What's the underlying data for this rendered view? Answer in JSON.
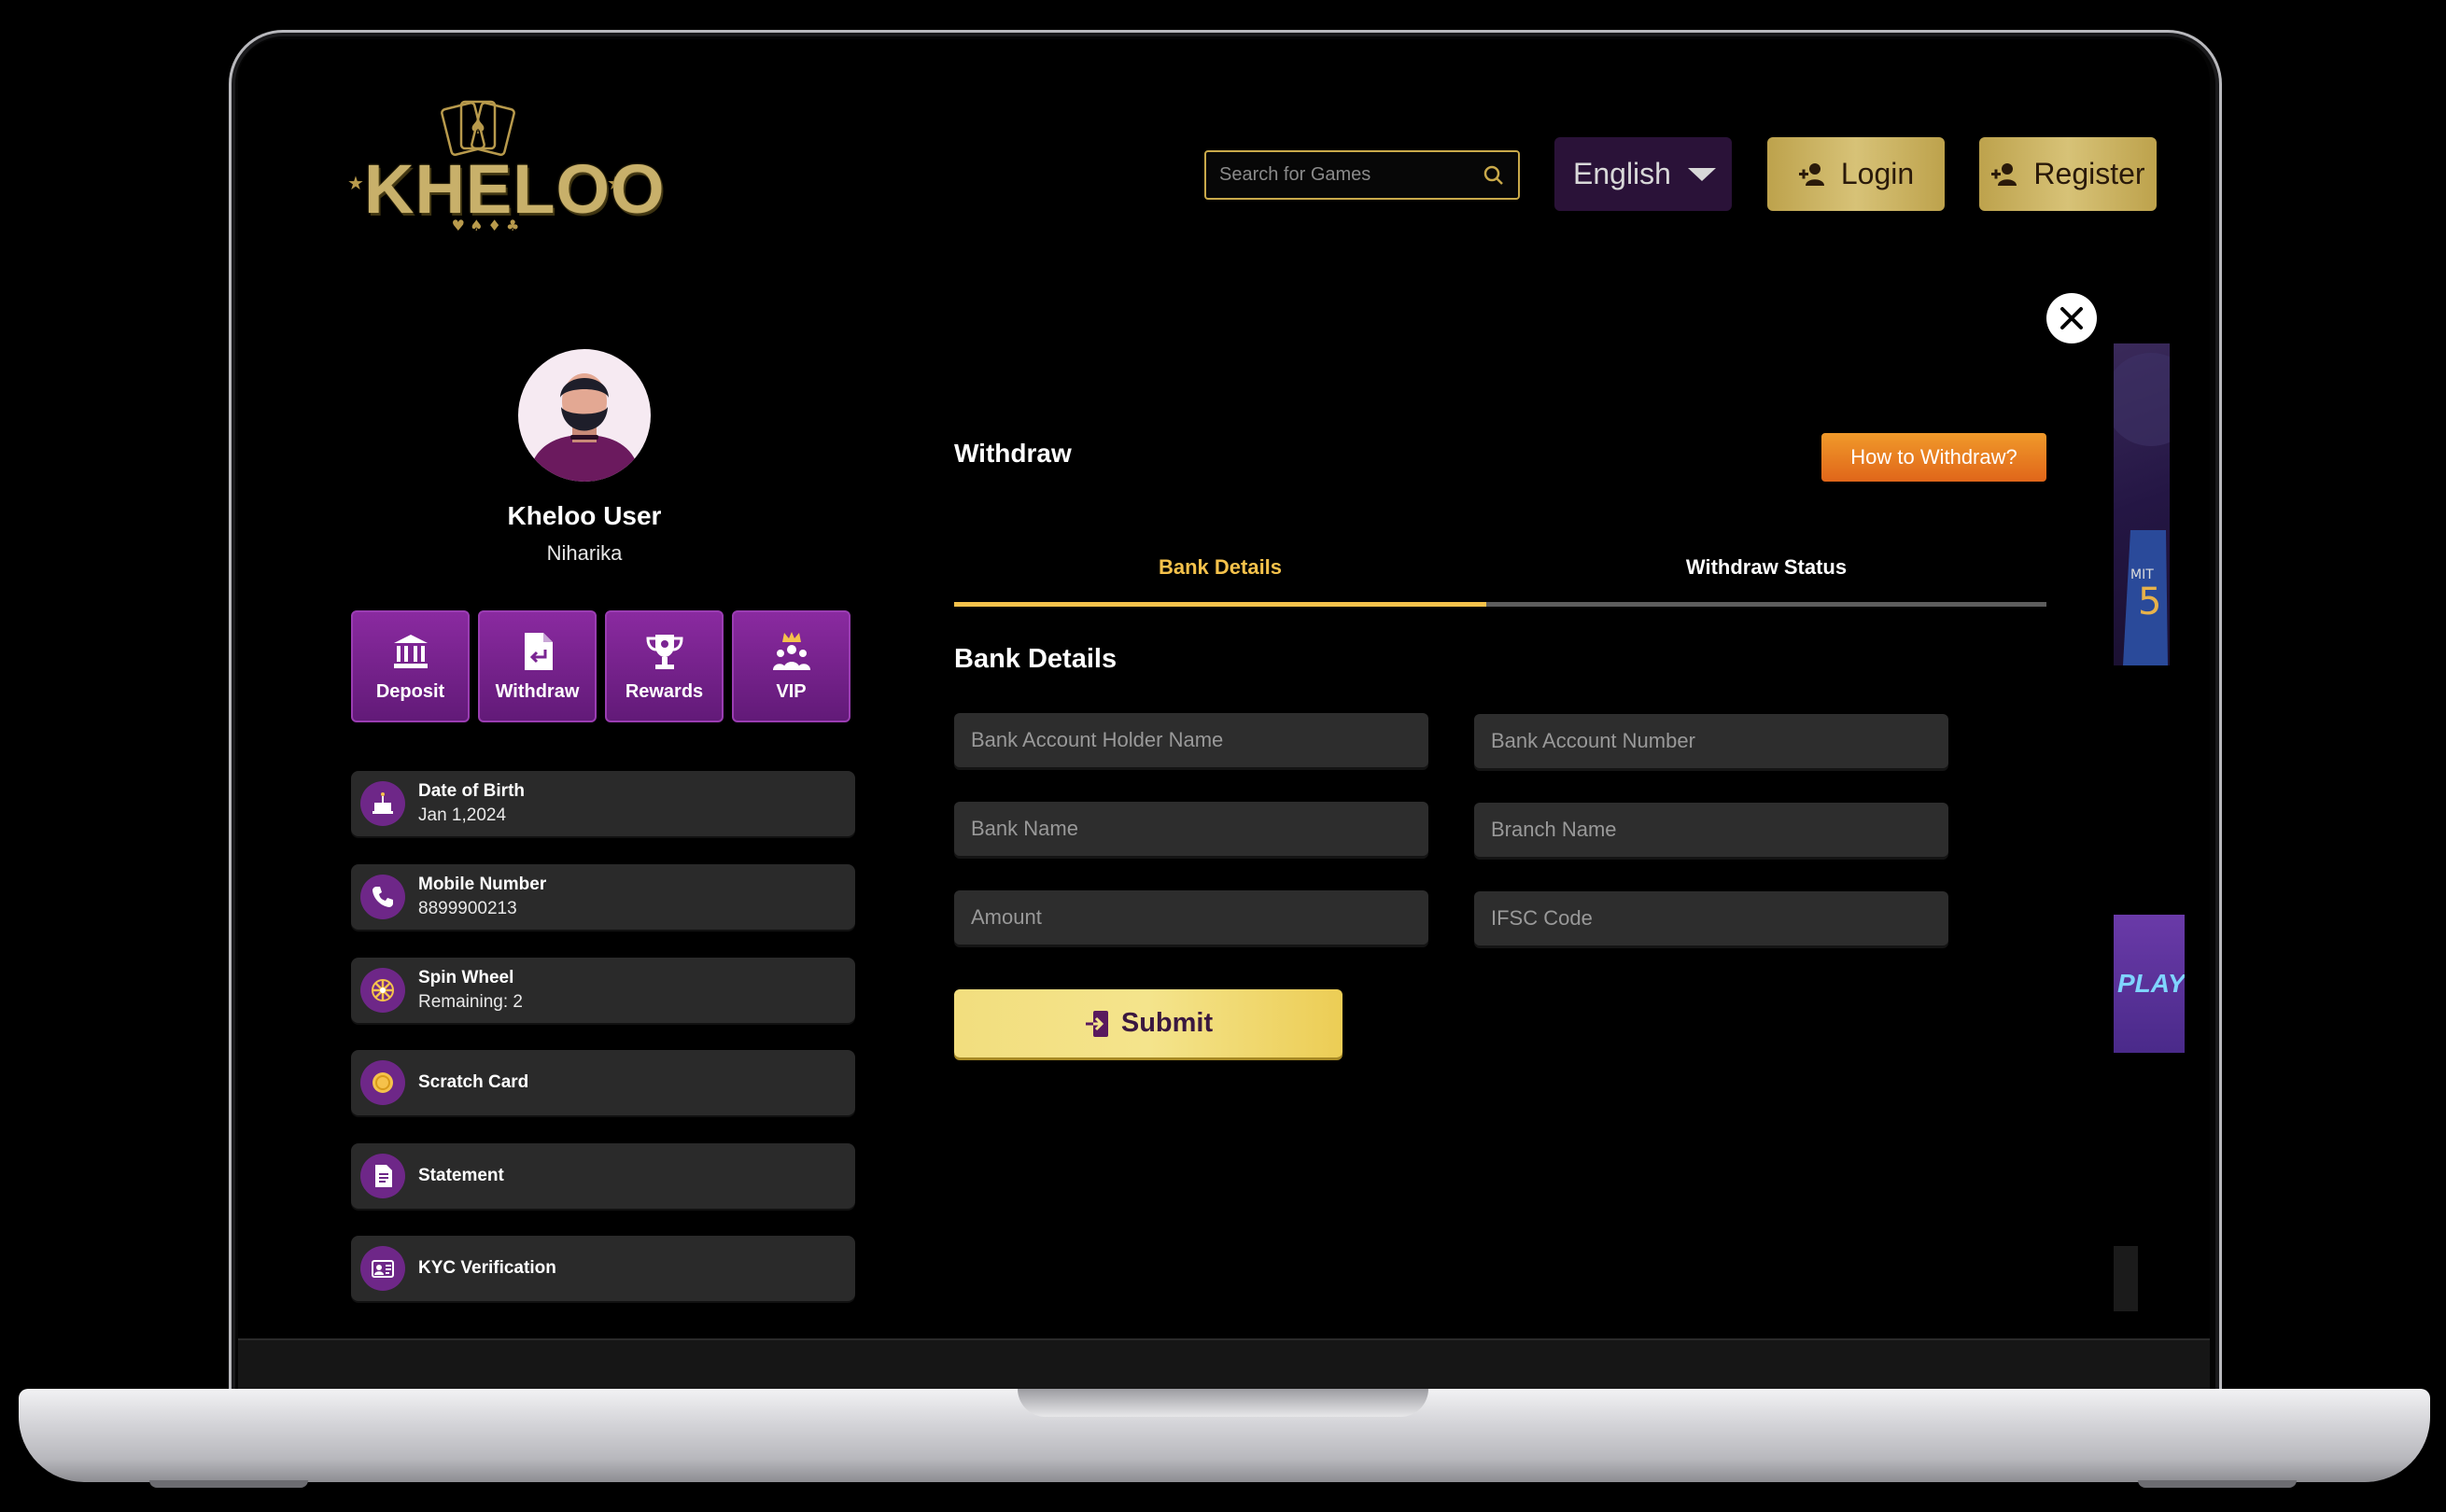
{
  "header": {
    "logo_text": "KHELOO",
    "search_placeholder": "Search for Games",
    "language": "English",
    "login_label": "Login",
    "register_label": "Register"
  },
  "profile": {
    "name": "Kheloo User",
    "username": "Niharika",
    "quick_actions": [
      {
        "label": "Deposit",
        "icon": "bank-icon"
      },
      {
        "label": "Withdraw",
        "icon": "withdraw-doc-icon"
      },
      {
        "label": "Rewards",
        "icon": "trophy-icon"
      },
      {
        "label": "VIP",
        "icon": "vip-crown-icon"
      }
    ],
    "info_rows": [
      {
        "title": "Date of Birth",
        "value": "Jan 1,2024",
        "icon": "cake-icon"
      },
      {
        "title": "Mobile Number",
        "value": "8899900213",
        "icon": "phone-icon"
      },
      {
        "title": "Spin Wheel",
        "value": "Remaining: 2",
        "icon": "spin-wheel-icon"
      },
      {
        "title": "Scratch Card",
        "icon": "coin-icon"
      },
      {
        "title": "Statement",
        "icon": "document-icon"
      },
      {
        "title": "KYC Verification",
        "icon": "id-card-icon"
      }
    ]
  },
  "withdraw": {
    "title": "Withdraw",
    "how_to_label": "How to Withdraw?",
    "tabs": [
      "Bank Details",
      "Withdraw Status"
    ],
    "section_title": "Bank Details",
    "fields": {
      "holder_name": "Bank Account Holder Name",
      "account_number": "Bank Account Number",
      "bank_name": "Bank Name",
      "branch_name": "Branch Name",
      "amount": "Amount",
      "ifsc": "IFSC Code"
    },
    "submit_label": "Submit"
  },
  "side_banner": {
    "text": "PLAY"
  },
  "colors": {
    "accent_gold": "#f5c24b",
    "purple": "#6e2788",
    "orange": "#e0661a"
  }
}
